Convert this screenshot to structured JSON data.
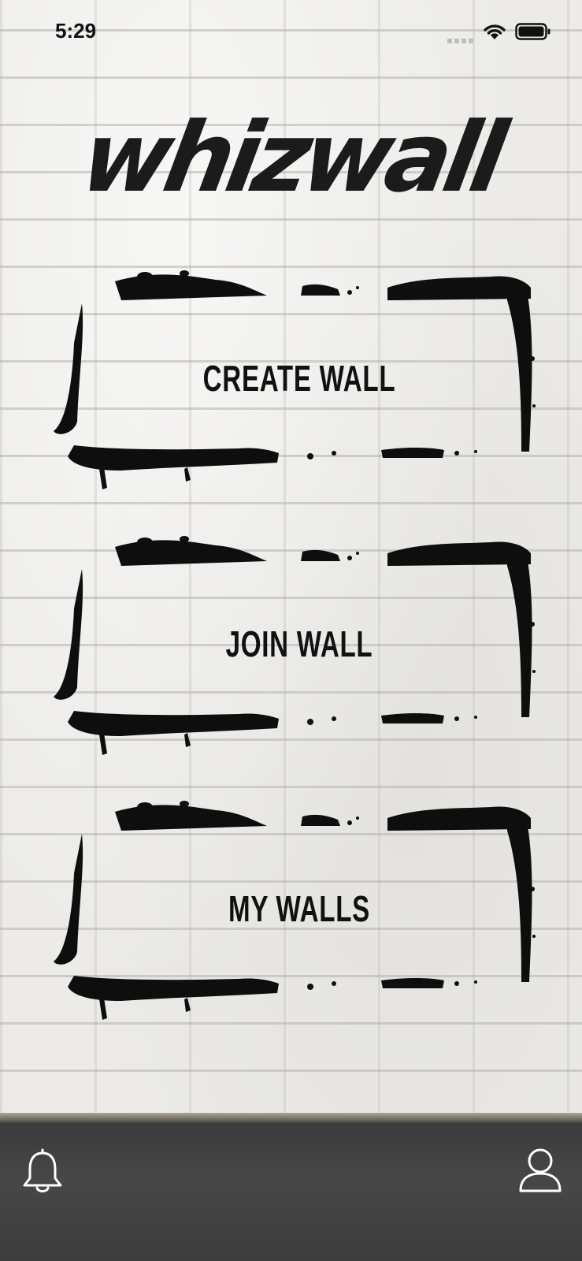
{
  "status_bar": {
    "time": "5:29",
    "icons": [
      "signal-icon",
      "wifi-icon",
      "battery-icon"
    ]
  },
  "app": {
    "logo_text": "whizwall"
  },
  "menu": {
    "create_wall_label": "CREATE WALL",
    "join_wall_label": "JOIN WALL",
    "my_walls_label": "MY WALLS"
  },
  "bottom_bar": {
    "left_icon": "bell-icon",
    "right_icon": "profile-icon"
  },
  "colors": {
    "paint": "#111111",
    "wall": "#ecebe8",
    "ground": "#404040",
    "icon_stroke": "#ffffff"
  }
}
